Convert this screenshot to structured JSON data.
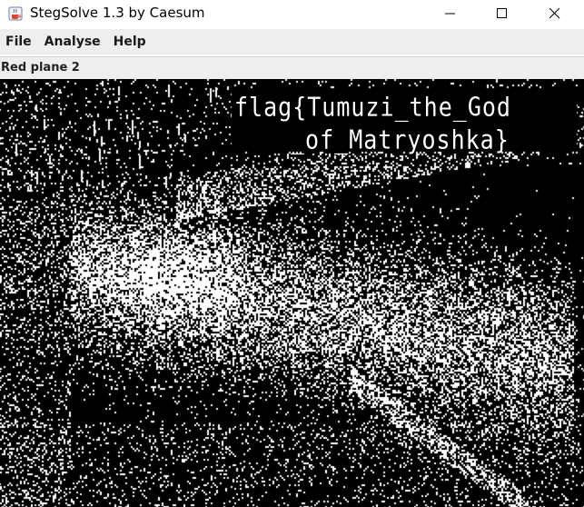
{
  "window": {
    "title": "StegSolve 1.3 by Caesum",
    "app_icon": "java-cup-icon",
    "controls": [
      "minimize-icon",
      "maximize-icon",
      "close-icon"
    ]
  },
  "menu": {
    "items": [
      {
        "label": "File"
      },
      {
        "label": "Analyse"
      },
      {
        "label": "Help"
      }
    ]
  },
  "view": {
    "plane_label": "Red plane 2",
    "hidden_text_line1": "flag{Tumuzi_the_God",
    "hidden_text_line2": "_of_Matryoshka}",
    "colors": {
      "background": "#000000",
      "foreground": "#ffffff"
    }
  }
}
